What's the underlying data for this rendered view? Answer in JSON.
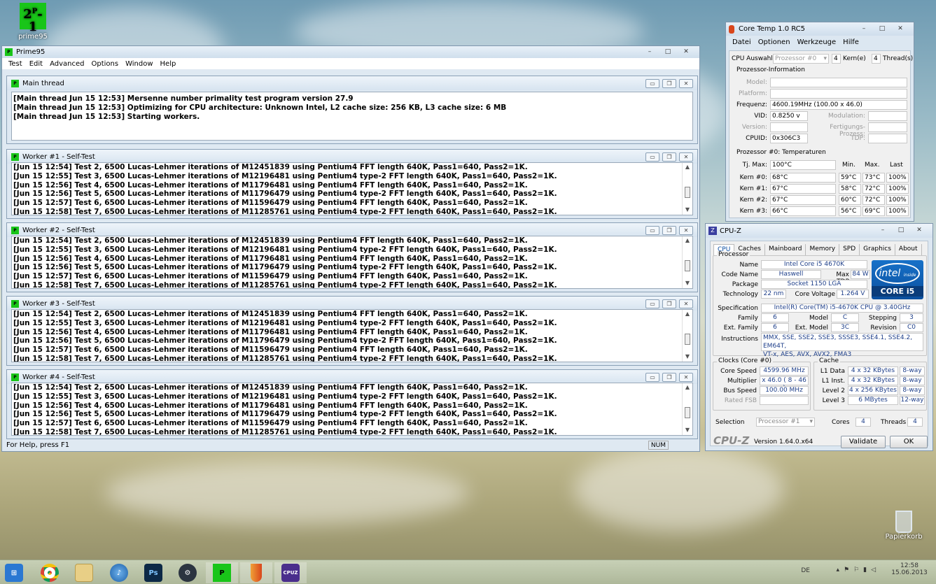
{
  "desktop": {
    "prime_icon_label": "prime95",
    "recycle_label": "Papierkorb"
  },
  "prime": {
    "title": "Prime95",
    "menu": [
      "Test",
      "Edit",
      "Advanced",
      "Options",
      "Window",
      "Help"
    ],
    "status": "For Help, press F1",
    "num": "NUM",
    "main": {
      "title": "Main thread",
      "lines": [
        "[Main thread Jun 15 12:53] Mersenne number primality test program version 27.9",
        "[Main thread Jun 15 12:53] Optimizing for CPU architecture: Unknown Intel, L2 cache size: 256 KB, L3 cache size: 6 MB",
        "[Main thread Jun 15 12:53] Starting workers."
      ]
    },
    "workers": [
      {
        "title": "Worker #1 - Self-Test"
      },
      {
        "title": "Worker #2 - Self-Test"
      },
      {
        "title": "Worker #3 - Self-Test"
      },
      {
        "title": "Worker #4 - Self-Test"
      }
    ],
    "worker_lines": [
      "[Jun 15 12:54] Test 2, 6500 Lucas-Lehmer iterations of M12451839 using Pentium4 FFT length 640K, Pass1=640, Pass2=1K.",
      "[Jun 15 12:55] Test 3, 6500 Lucas-Lehmer iterations of M12196481 using Pentium4 type-2 FFT length 640K, Pass1=640, Pass2=1K.",
      "[Jun 15 12:56] Test 4, 6500 Lucas-Lehmer iterations of M11796481 using Pentium4 FFT length 640K, Pass1=640, Pass2=1K.",
      "[Jun 15 12:56] Test 5, 6500 Lucas-Lehmer iterations of M11796479 using Pentium4 type-2 FFT length 640K, Pass1=640, Pass2=1K.",
      "[Jun 15 12:57] Test 6, 6500 Lucas-Lehmer iterations of M11596479 using Pentium4 FFT length 640K, Pass1=640, Pass2=1K.",
      "[Jun 15 12:58] Test 7, 6500 Lucas-Lehmer iterations of M11285761 using Pentium4 type-2 FFT length 640K, Pass1=640, Pass2=1K."
    ]
  },
  "coretemp": {
    "title": "Core Temp 1.0 RC5",
    "menu": [
      "Datei",
      "Optionen",
      "Werkzeuge",
      "Hilfe"
    ],
    "cpu_select_label": "CPU Auswahl:",
    "cpu_select_value": "Prozessor #0",
    "cores_value": "4",
    "cores_label": "Kern(e)",
    "threads_value": "4",
    "threads_label": "Thread(s)",
    "info_title": "Prozessor-Information",
    "model_label": "Model:",
    "platform_label": "Platform:",
    "frequency_label": "Frequenz:",
    "frequency_value": "4600.19MHz (100.00 x 46.0)",
    "vid_label": "VID:",
    "vid_value": "0.8250 v",
    "modulation_label": "Modulation:",
    "version_label": "Version:",
    "fertigung_label": "Fertigungs-Prozess:",
    "cpuid_label": "CPUID:",
    "cpuid_value": "0x306C3",
    "tdp_label": "TDP:",
    "temps_title": "Prozessor #0: Temperaturen",
    "tjmax_label": "Tj. Max:",
    "tjmax_value": "100°C",
    "col_min": "Min.",
    "col_max": "Max.",
    "col_last": "Last",
    "cores": [
      {
        "label": "Kern #0:",
        "temp": "68°C",
        "min": "59°C",
        "max": "73°C",
        "load": "100%"
      },
      {
        "label": "Kern #1:",
        "temp": "67°C",
        "min": "58°C",
        "max": "72°C",
        "load": "100%"
      },
      {
        "label": "Kern #2:",
        "temp": "67°C",
        "min": "60°C",
        "max": "72°C",
        "load": "100%"
      },
      {
        "label": "Kern #3:",
        "temp": "66°C",
        "min": "56°C",
        "max": "69°C",
        "load": "100%"
      }
    ]
  },
  "cpuz": {
    "title": "CPU-Z",
    "tabs": [
      "CPU",
      "Caches",
      "Mainboard",
      "Memory",
      "SPD",
      "Graphics",
      "About"
    ],
    "processor_group": "Processor",
    "name_label": "Name",
    "name_value": "Intel Core i5 4670K",
    "codename_label": "Code Name",
    "codename_value": "Haswell",
    "maxtdp_label": "Max TDP",
    "maxtdp_value": "84 W",
    "package_label": "Package",
    "package_value": "Socket 1150 LGA",
    "tech_label": "Technology",
    "tech_value": "22 nm",
    "voltage_label": "Core Voltage",
    "voltage_value": "1.264 V",
    "spec_label": "Specification",
    "spec_value": "Intel(R) Core(TM) i5-4670K CPU @ 3.40GHz",
    "family_label": "Family",
    "family_value": "6",
    "model_label": "Model",
    "model_value": "C",
    "stepping_label": "Stepping",
    "stepping_value": "3",
    "extfamily_label": "Ext. Family",
    "extfamily_value": "6",
    "extmodel_label": "Ext. Model",
    "extmodel_value": "3C",
    "revision_label": "Revision",
    "revision_value": "C0",
    "instr_label": "Instructions",
    "instr_value1": "MMX, SSE, SSE2, SSE3, SSSE3, SSE4.1, SSE4.2, EM64T,",
    "instr_value2": "VT-x, AES, AVX, AVX2, FMA3",
    "logo_word": "intel",
    "logo_inside": "inside",
    "logo_core": "CORE i5",
    "clocks_group": "Clocks (Core #0)",
    "corespeed_label": "Core Speed",
    "corespeed_value": "4599.96 MHz",
    "mult_label": "Multiplier",
    "mult_value": "x 46.0 ( 8 - 46 )",
    "bus_label": "Bus Speed",
    "bus_value": "100.00 MHz",
    "fsb_label": "Rated FSB",
    "cache_group": "Cache",
    "cache": [
      {
        "label": "L1 Data",
        "size": "4 x 32 KBytes",
        "way": "8-way"
      },
      {
        "label": "L1 Inst.",
        "size": "4 x 32 KBytes",
        "way": "8-way"
      },
      {
        "label": "Level 2",
        "size": "4 x 256 KBytes",
        "way": "8-way"
      },
      {
        "label": "Level 3",
        "size": "6 MBytes",
        "way": "12-way"
      }
    ],
    "selection_label": "Selection",
    "selection_value": "Processor #1",
    "cores_label": "Cores",
    "cores_value": "4",
    "threads_label": "Threads",
    "threads_value": "4",
    "brand": "CPU-Z",
    "version": "Version 1.64.0.x64",
    "validate": "Validate",
    "ok": "OK"
  },
  "taskbar": {
    "lang": "DE",
    "time": "12:58",
    "date": "15.06.2013",
    "items": [
      "start-icon",
      "chrome-icon",
      "explorer-icon",
      "itunes-icon",
      "photoshop-icon",
      "steam-icon",
      "prime95-icon",
      "coretemp-icon",
      "cpuz-icon"
    ],
    "ps_text": "Ps",
    "cpuz_text": "CPUZ"
  },
  "colors": {
    "prime_green": "#19c519",
    "cpuz_blue": "#1e3f8a",
    "intel_blue": "#1771c8"
  }
}
